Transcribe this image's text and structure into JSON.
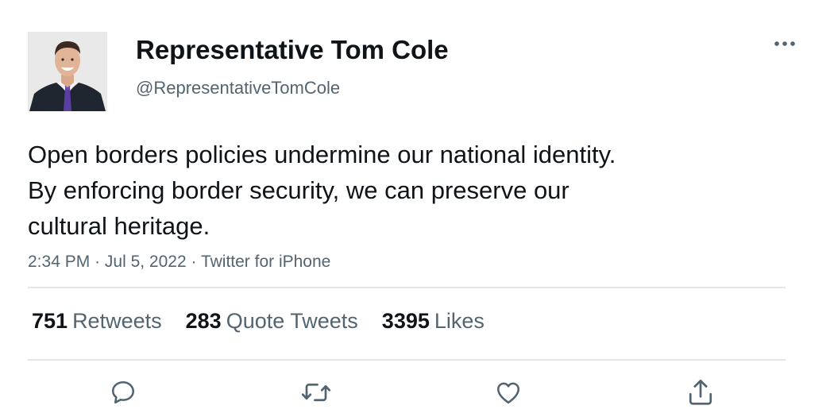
{
  "author": {
    "display_name": "Representative Tom Cole",
    "handle": "@RepresentativeTomCole"
  },
  "tweet": {
    "text_lines": [
      "Open borders policies undermine our national identity.",
      "By enforcing border security, we can preserve our",
      "cultural heritage."
    ],
    "time": "2:34 PM",
    "date": "Jul 5, 2022",
    "source": "Twitter for iPhone",
    "separator": "·"
  },
  "stats": {
    "retweets_count": "751",
    "retweets_label": "Retweets",
    "quotes_count": "283",
    "quotes_label": "Quote Tweets",
    "likes_count": "3395",
    "likes_label": "Likes"
  },
  "icons": {
    "more": "more-horizontal-icon",
    "reply": "reply-icon",
    "retweet": "retweet-icon",
    "like": "heart-icon",
    "share": "share-icon"
  },
  "colors": {
    "text_primary": "#0f1419",
    "text_secondary": "#536471",
    "divider": "#e4e6e8",
    "icon": "#536471"
  }
}
